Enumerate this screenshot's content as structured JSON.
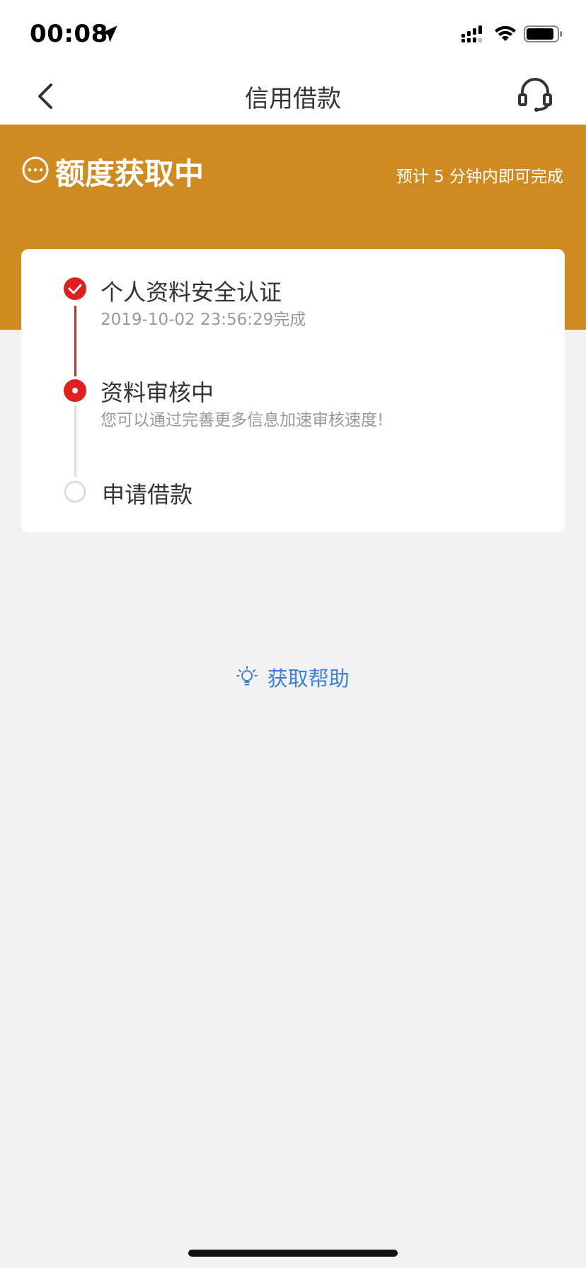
{
  "status_bar": {
    "time": "00:08",
    "icons": [
      "location-arrow-icon",
      "signal-icon",
      "wifi-icon",
      "battery-icon"
    ]
  },
  "nav": {
    "title": "信用借款",
    "back_icon": "chevron-left-icon",
    "service_icon": "headset-icon"
  },
  "banner": {
    "status_icon": "more-circle-icon",
    "title": "额度获取中",
    "note": "预计 5 分钟内即可完成",
    "color": "#d08a22"
  },
  "steps": [
    {
      "title": "个人资料安全认证",
      "subtitle": "2019-10-02 23:56:29完成",
      "state": "done",
      "icon": "check-circle-icon"
    },
    {
      "title": "资料审核中",
      "subtitle": "您可以通过完善更多信息加速审核速度!",
      "state": "current",
      "icon": "dot-circle-icon"
    },
    {
      "title": "申请借款",
      "subtitle": "",
      "state": "pending",
      "icon": "empty-circle-icon"
    }
  ],
  "help": {
    "label": "获取帮助",
    "icon": "lightbulb-icon",
    "color": "#3f7fdc"
  },
  "accent": "#e02020"
}
